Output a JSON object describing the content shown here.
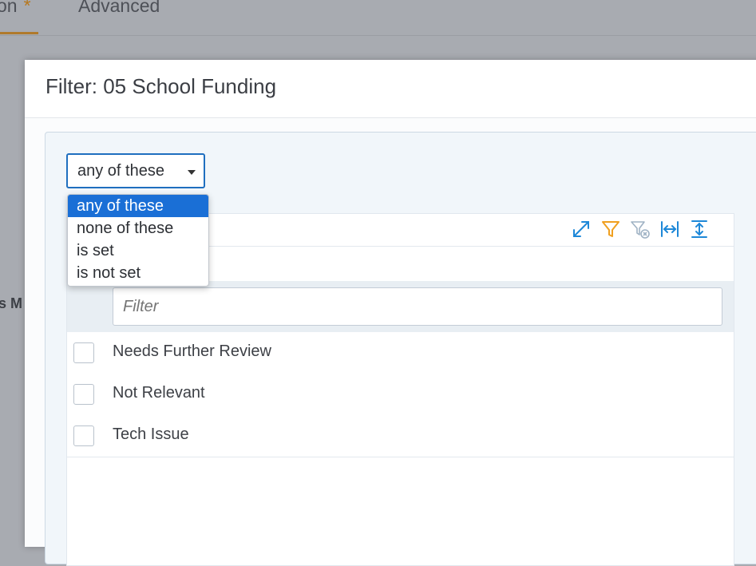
{
  "background": {
    "tab_active": "on",
    "tab_active_marker": "*",
    "tab_advanced": "Advanced",
    "side_label": "s M"
  },
  "dialog": {
    "title": "Filter: 05 School Funding"
  },
  "condition_select": {
    "value": "any of these",
    "options": [
      "any of these",
      "none of these",
      "is set",
      "is not set"
    ],
    "selected_index": 0
  },
  "toolbar": {
    "icons": [
      "expand-icon",
      "filter-icon",
      "clear-filter-icon",
      "fit-width-icon",
      "fit-height-icon"
    ],
    "color": "#1e88d8",
    "filter_color": "#f0a020"
  },
  "filter": {
    "placeholder": "Filter"
  },
  "rows": [
    {
      "label": "Needs Further Review",
      "checked": false
    },
    {
      "label": "Not Relevant",
      "checked": false
    },
    {
      "label": "Tech Issue",
      "checked": false
    }
  ],
  "colors": {
    "accent": "#1a6fd6",
    "overlay": "#a8abb1",
    "tab_marker": "#b7771c"
  }
}
